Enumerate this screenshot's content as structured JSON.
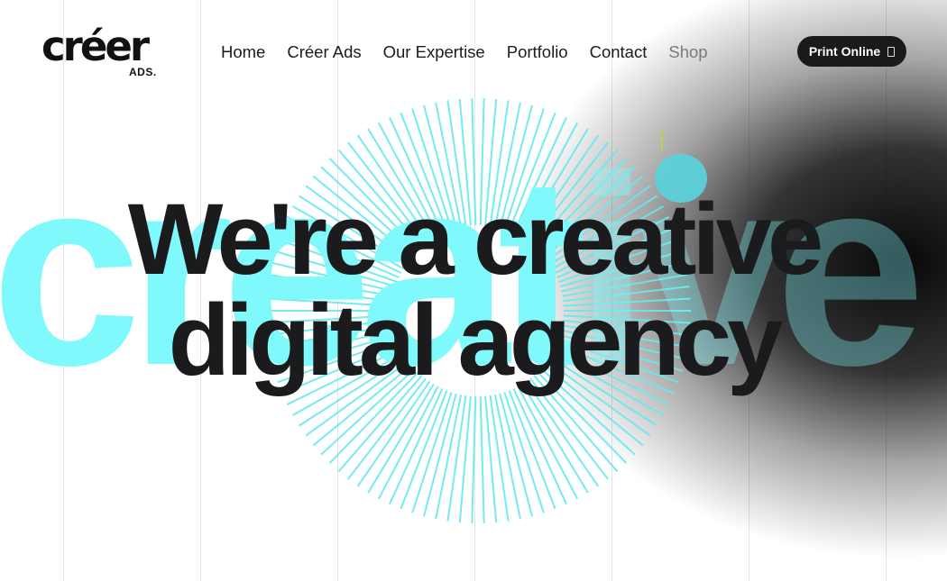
{
  "logo": {
    "main": "créer",
    "sub": "ADS."
  },
  "nav": {
    "items": [
      {
        "label": "Home"
      },
      {
        "label": "Créer Ads"
      },
      {
        "label": "Our Expertise"
      },
      {
        "label": "Portfolio"
      },
      {
        "label": "Contact"
      },
      {
        "label": "Shop"
      }
    ]
  },
  "cta": {
    "label": "Print Online",
    "icon": "bag-icon"
  },
  "hero": {
    "background_word": "creative",
    "headline_line1": "We're a creative",
    "headline_line2": "digital agency"
  },
  "colors": {
    "accent_cyan": "#7ff9fb",
    "dot_teal": "#5bd0d8",
    "text_dark": "#1b1b1d",
    "button_bg": "#1a1a1a",
    "nav_muted": "#7a7a7a"
  }
}
